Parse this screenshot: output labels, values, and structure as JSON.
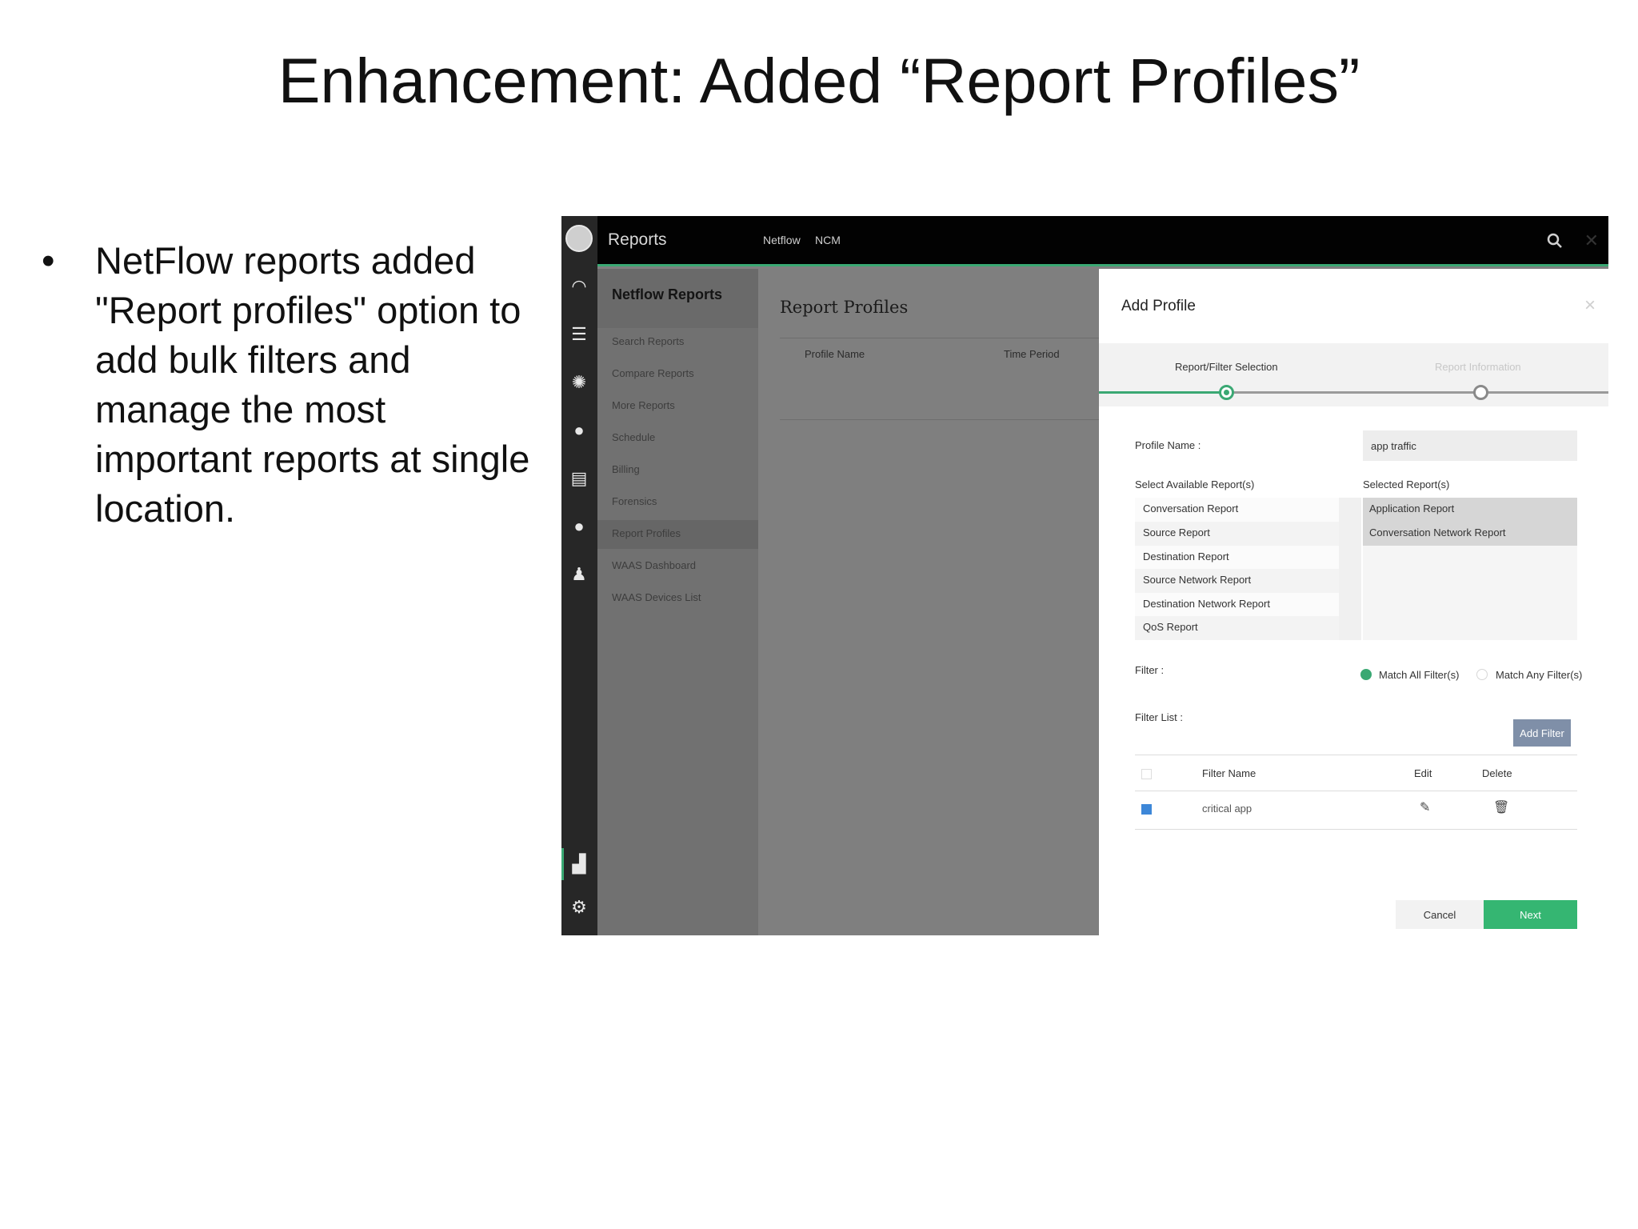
{
  "slide": {
    "title": "Enhancement: Added “Report Profiles”",
    "bullet_marker": "•",
    "bullet_text": "NetFlow reports added \"Report profiles\" option to add bulk filters and manage the most important reports at single location."
  },
  "app": {
    "title": "Reports",
    "tabs": [
      "Netflow",
      "NCM"
    ],
    "accent_color": "#3aa873"
  },
  "icon_rail": [
    "avatar",
    "dashboard-icon",
    "list-settings-icon",
    "alarm-icon",
    "map-pin-icon",
    "devices-icon",
    "chat-icon",
    "user-icon",
    "reports-chart-icon",
    "settings-gear-icon"
  ],
  "left_nav": {
    "heading": "Netflow Reports",
    "items": [
      "Search Reports",
      "Compare Reports",
      "More Reports",
      "Schedule",
      "Billing",
      "Forensics",
      "Report Profiles",
      "WAAS Dashboard",
      "WAAS Devices List"
    ],
    "active_index": 6
  },
  "content": {
    "title": "Report Profiles",
    "columns": [
      "Profile Name",
      "Time Period"
    ]
  },
  "panel": {
    "title": "Add Profile",
    "close": "×",
    "steps": [
      "Report/Filter Selection",
      "Report Information"
    ],
    "active_step": 0,
    "profile_name_label": "Profile Name :",
    "profile_name_value": "app traffic",
    "available_label": "Select Available Report(s)",
    "selected_label": "Selected Report(s)",
    "available_reports": [
      "Conversation Report",
      "Source Report",
      "Destination Report",
      "Source Network Report",
      "Destination Network Report",
      "QoS Report"
    ],
    "selected_reports": [
      "Application Report",
      "Conversation Network Report"
    ],
    "filter_label": "Filter :",
    "filter_options": [
      "Match All Filter(s)",
      "Match Any Filter(s)"
    ],
    "filter_selected_index": 0,
    "filter_list_label": "Filter List :",
    "add_filter_label": "Add Filter",
    "filter_table": {
      "headers": [
        "Filter Name",
        "Edit",
        "Delete"
      ],
      "rows": [
        {
          "name": "critical app",
          "checked": true
        }
      ]
    },
    "cancel_label": "Cancel",
    "next_label": "Next"
  }
}
